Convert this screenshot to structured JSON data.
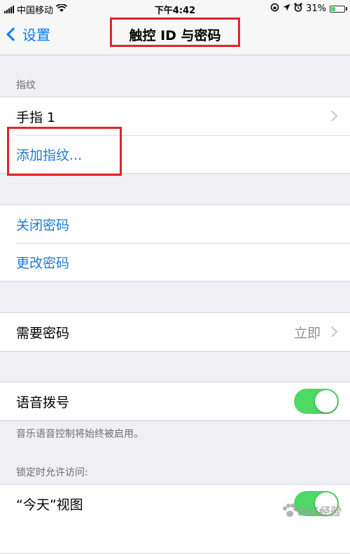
{
  "status_bar": {
    "carrier": "中国移动",
    "time": "下午4:42",
    "battery_percent": "31%",
    "battery_level": 0.31,
    "icons": [
      "signal-icon",
      "wifi-icon",
      "rotation-lock-icon",
      "location-icon",
      "alarm-icon",
      "battery-icon"
    ]
  },
  "nav": {
    "back_label": "设置",
    "title": "触控 ID 与密码"
  },
  "sections": {
    "fingerprint_header": "指纹",
    "fingerprint_rows": [
      "手指 1",
      "添加指纹..."
    ],
    "passcode_rows": [
      "关闭密码",
      "更改密码"
    ],
    "require_passcode": {
      "label": "需要密码",
      "value": "立即"
    },
    "voice_dial": {
      "label": "语音拨号",
      "enabled": true
    },
    "voice_dial_note": "音乐语音控制将始终被启用。",
    "locked_access_header": "锁定时允许访问:",
    "locked_rows": [
      {
        "label": "“今天”视图",
        "enabled": true
      }
    ]
  },
  "watermark": {
    "text": "Bai经验"
  },
  "colors": {
    "accent_blue": "#007aff",
    "link_blue": "#1a7bd4",
    "toggle_green": "#4cd964",
    "annotation_red": "#e0242b",
    "background": "#efeff4"
  }
}
